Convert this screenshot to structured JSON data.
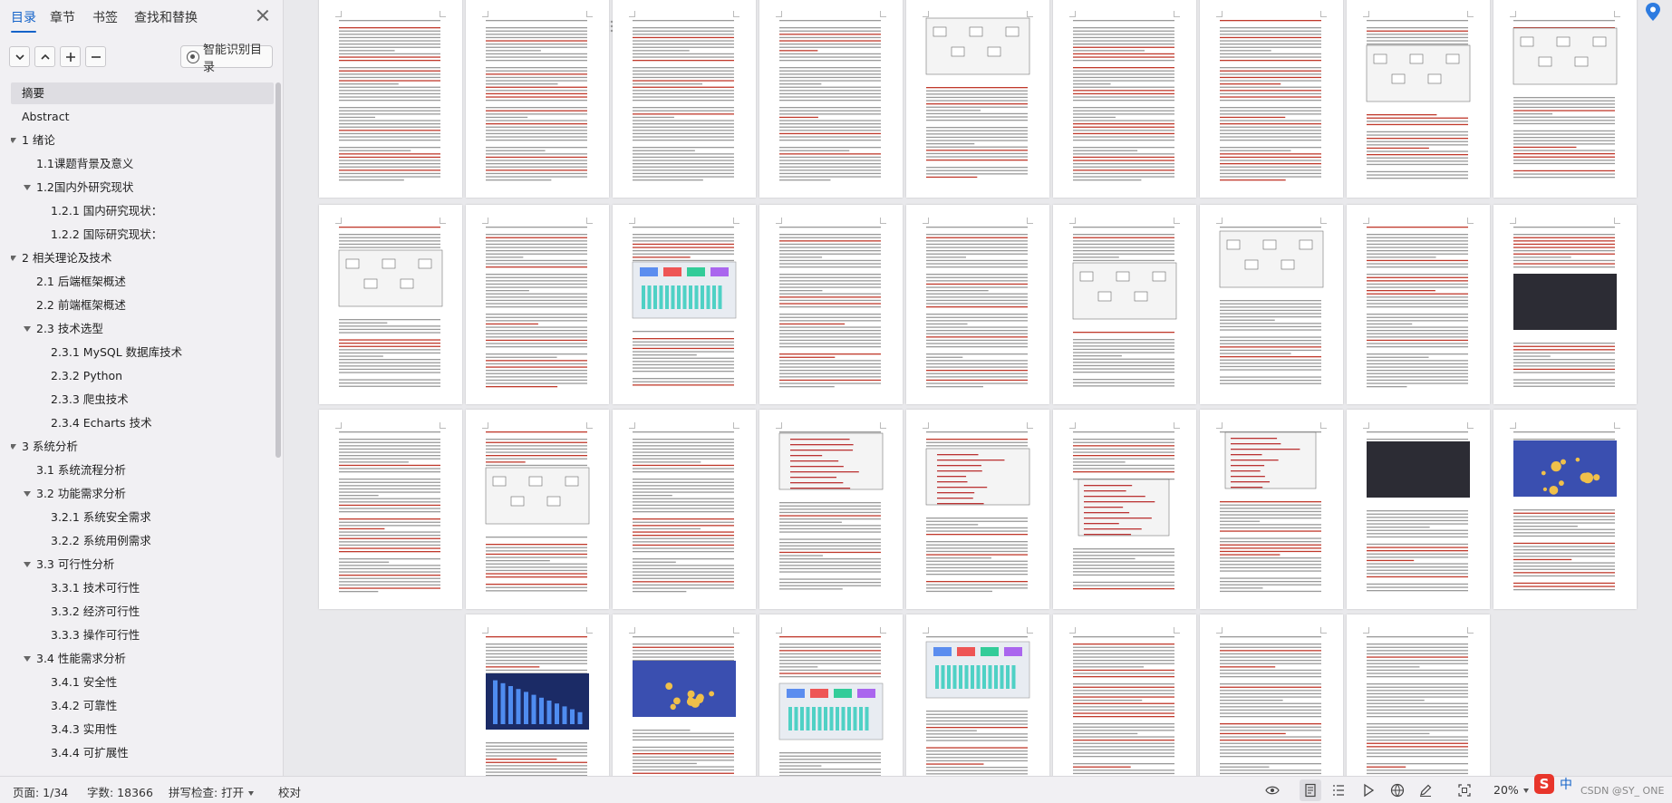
{
  "nav": {
    "tabs": [
      "目录",
      "章节",
      "书签",
      "查找和替换"
    ],
    "smart_toc_label": "智能识别目录",
    "toc": [
      {
        "label": "摘要",
        "level": 0,
        "expandable": false,
        "selected": true
      },
      {
        "label": "Abstract",
        "level": 0,
        "expandable": false
      },
      {
        "label": "1  绪论",
        "level": 0,
        "expandable": true
      },
      {
        "label": "1.1课题背景及意义",
        "level": 1,
        "expandable": false
      },
      {
        "label": "1.2国内外研究现状",
        "level": 1,
        "expandable": true
      },
      {
        "label": "1.2.1  国内研究现状：",
        "level": 2,
        "expandable": false
      },
      {
        "label": "1.2.2  国际研究现状：",
        "level": 2,
        "expandable": false
      },
      {
        "label": "2  相关理论及技术",
        "level": 0,
        "expandable": true
      },
      {
        "label": "2.1  后端框架概述",
        "level": 1,
        "expandable": false
      },
      {
        "label": "2.2  前端框架概述",
        "level": 1,
        "expandable": false
      },
      {
        "label": "2.3  技术选型",
        "level": 1,
        "expandable": true
      },
      {
        "label": "2.3.1 MySQL  数据库技术",
        "level": 2,
        "expandable": false
      },
      {
        "label": "2.3.2 Python",
        "level": 2,
        "expandable": false
      },
      {
        "label": "2.3.3  爬虫技术",
        "level": 2,
        "expandable": false
      },
      {
        "label": "2.3.4 Echarts  技术",
        "level": 2,
        "expandable": false
      },
      {
        "label": "3  系统分析",
        "level": 0,
        "expandable": true
      },
      {
        "label": "3.1 系统流程分析",
        "level": 1,
        "expandable": false
      },
      {
        "label": "3.2 功能需求分析",
        "level": 1,
        "expandable": true
      },
      {
        "label": "3.2.1  系统安全需求",
        "level": 2,
        "expandable": false
      },
      {
        "label": "3.2.2  系统用例需求",
        "level": 2,
        "expandable": false
      },
      {
        "label": "3.3  可行性分析",
        "level": 1,
        "expandable": true
      },
      {
        "label": "3.3.1  技术可行性",
        "level": 2,
        "expandable": false
      },
      {
        "label": "3.3.2  经济可行性",
        "level": 2,
        "expandable": false
      },
      {
        "label": "3.3.3  操作可行性",
        "level": 2,
        "expandable": false
      },
      {
        "label": "3.4  性能需求分析",
        "level": 1,
        "expandable": true
      },
      {
        "label": "3.4.1  安全性",
        "level": 2,
        "expandable": false
      },
      {
        "label": "3.4.2  可靠性",
        "level": 2,
        "expandable": false
      },
      {
        "label": "3.4.3  实用性",
        "level": 2,
        "expandable": false
      },
      {
        "label": "3.4.4  可扩展性",
        "level": 2,
        "expandable": false
      }
    ]
  },
  "doc": {
    "hint": "H"
  },
  "statusbar": {
    "page": "页面: 1/34",
    "words": "字数: 18366",
    "spellcheck": "拼写检查: 打开",
    "proof": "校对",
    "zoom": "20%"
  },
  "ime": {
    "logo": "S",
    "lang": "中"
  },
  "watermark": "CSDN @SY_ ONE",
  "colors": {
    "accent": "#1463c9",
    "pane_bg": "#f1f0f3",
    "doc_bg": "#e9e9ec"
  }
}
